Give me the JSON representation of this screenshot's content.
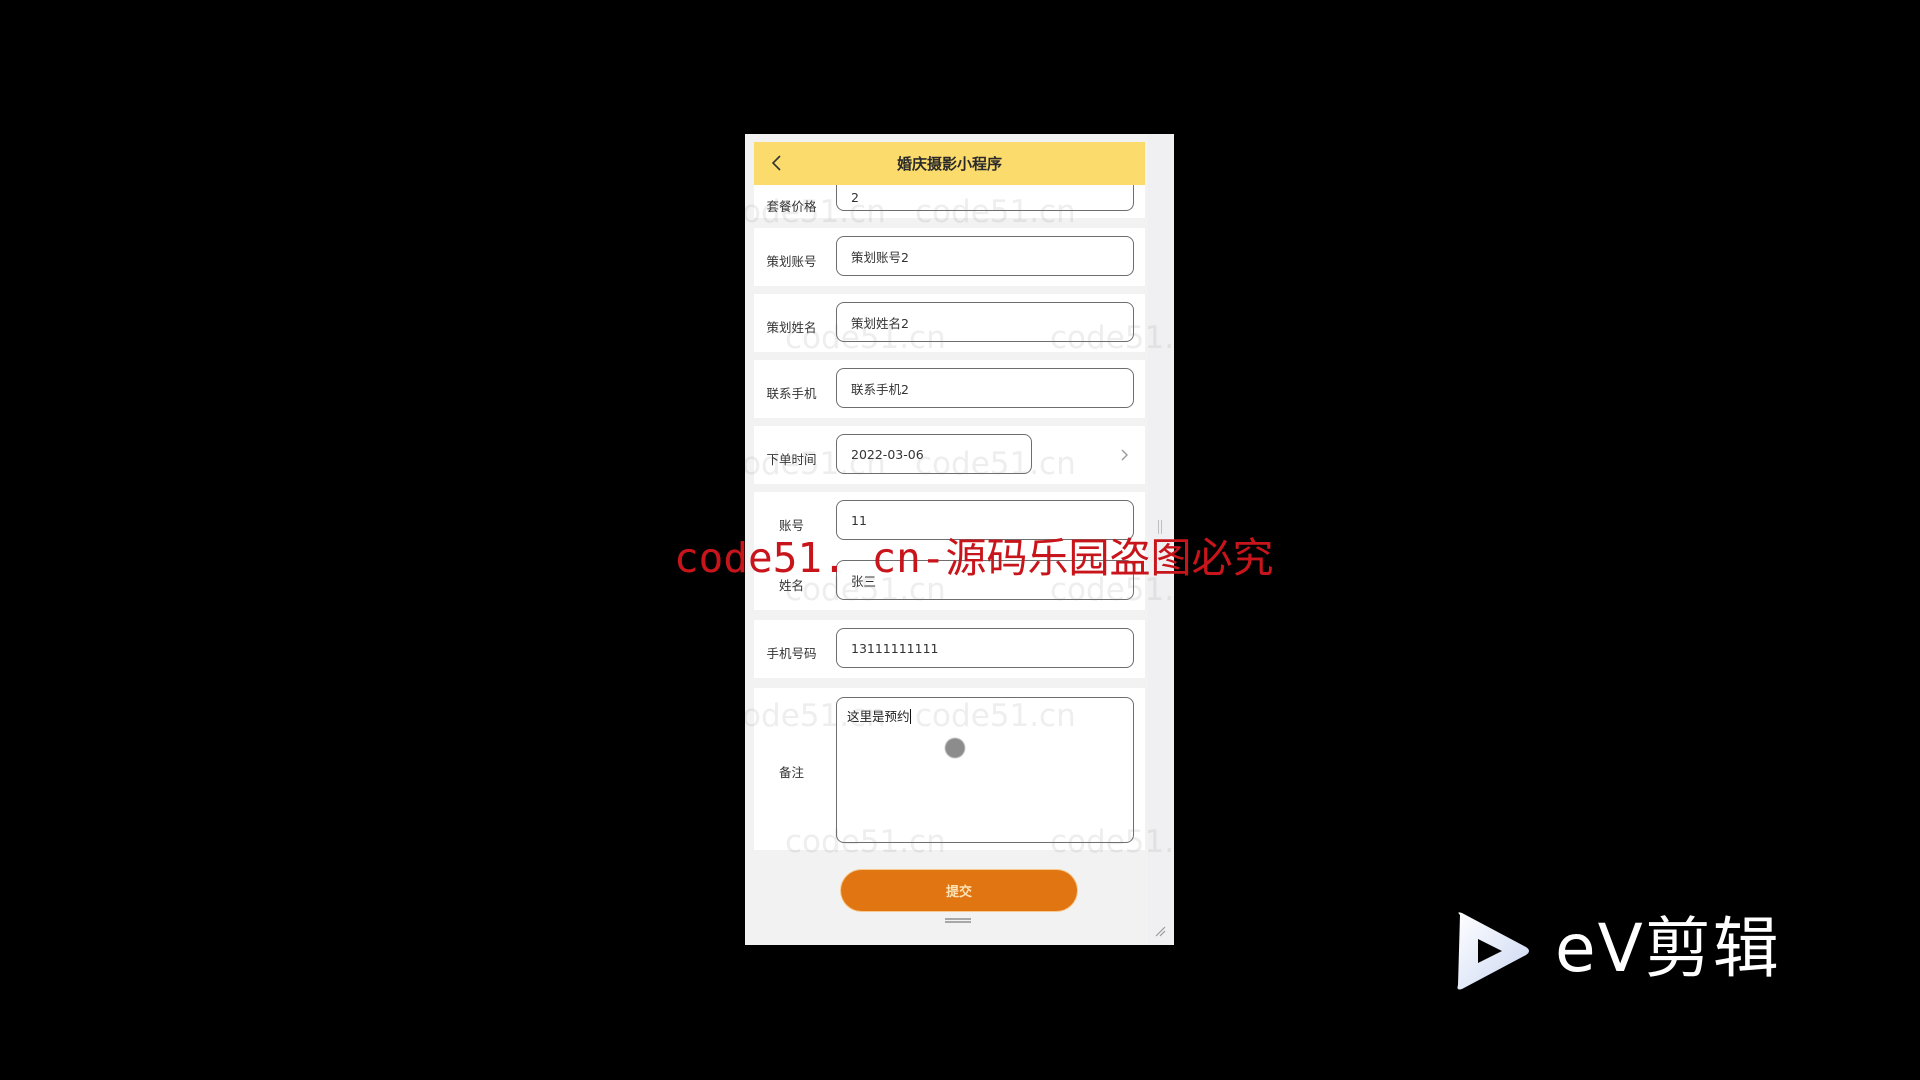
{
  "header": {
    "title": "婚庆摄影小程序",
    "back_icon": "chevron-left-icon"
  },
  "form": {
    "fields": [
      {
        "label": "套餐价格",
        "value": "2"
      },
      {
        "label": "策划账号",
        "value": "策划账号2"
      },
      {
        "label": "策划姓名",
        "value": "策划姓名2"
      },
      {
        "label": "联系手机",
        "value": "联系手机2"
      },
      {
        "label": "下单时间",
        "value": "2022-03-06",
        "icon": "chevron-right-icon"
      },
      {
        "label": "账号",
        "value": "11"
      },
      {
        "label": "姓名",
        "value": "张三"
      },
      {
        "label": "手机号码",
        "value": "13111111111"
      },
      {
        "label": "备注",
        "value": "这里是预约"
      }
    ],
    "submit_label": "提交"
  },
  "watermarks": {
    "grey_text": "code51.cn",
    "red_text": "code51. cn-源码乐园盗图必究"
  },
  "ev_logo": {
    "text": "eV剪辑",
    "icon": "play-icon"
  },
  "colors": {
    "header_bg": "#FADB6C",
    "submit_bg": "#E07512",
    "watermark_red": "#C8151B"
  }
}
